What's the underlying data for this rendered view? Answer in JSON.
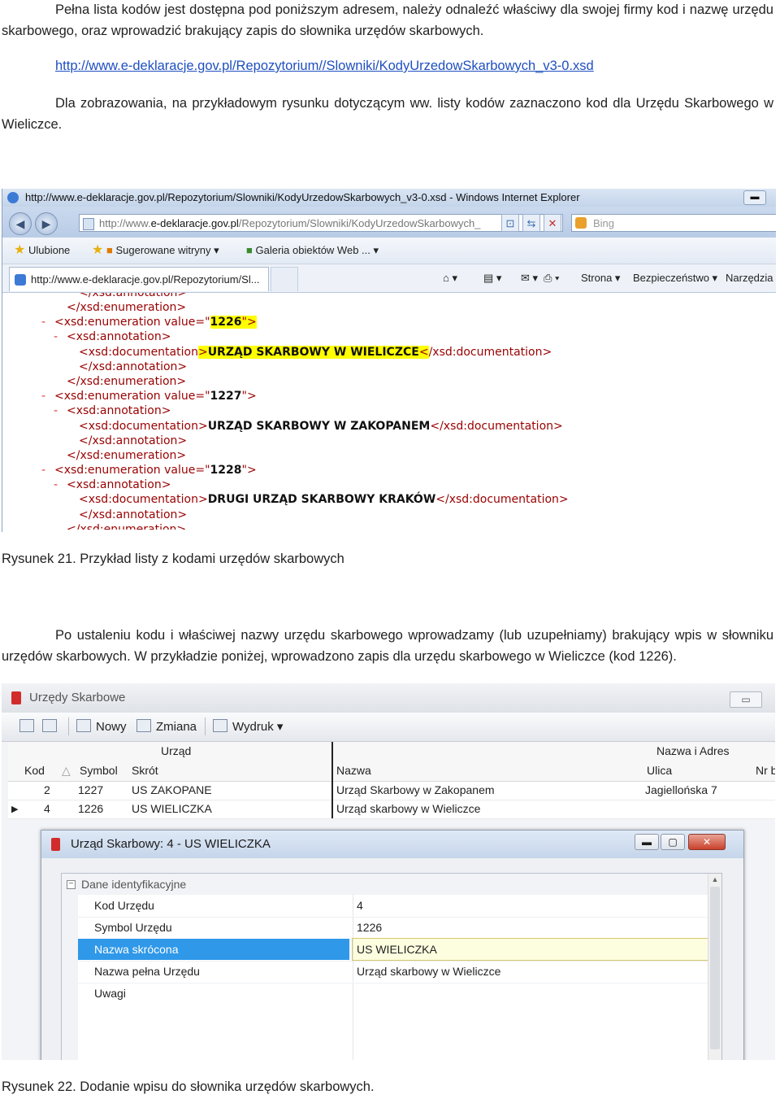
{
  "intro": {
    "text": "Pełna lista kodów jest dostępna pod poniższym adresem, należy odnaleźć właściwy dla swojej firmy kod i nazwę urzędu skarbowego, oraz wprowadzić brakujący zapis do słownika urzędów skarbowych.",
    "link": "http://www.e-deklaracje.gov.pl/Repozytorium//Slowniki/KodyUrzedowSkarbowych_v3-0.xsd",
    "example": "Dla zobrazowania, na przykładowym rysunku dotyczącym ww. listy kodów zaznaczono kod dla Urzędu Skarbowego w Wieliczce."
  },
  "figure21": {
    "window_title": "http://www.e-deklaracje.gov.pl/Repozytorium/Slowniki/KodyUrzedowSkarbowych_v3-0.xsd - Windows Internet Explorer",
    "address_prefix": "http://www.",
    "address_domain": "e-deklaracje.gov.pl",
    "address_rest": "/Repozytorium/Slowniki/KodyUrzedowSkarbowych_",
    "search_placeholder": "Bing",
    "favorites": [
      "Ulubione",
      "Sugerowane witryny ▾",
      "Galeria obiektów Web ... ▾"
    ],
    "tab_title": "http://www.e-deklaracje.gov.pl/Repozytorium/Sl...",
    "commands": [
      "Strona ▾",
      "Bezpieczeństwo ▾",
      "Narzędzia ▾"
    ],
    "xml_lines": [
      {
        "indent": 6,
        "marker": "",
        "tag": "</xsd:annotation>",
        "cut": true
      },
      {
        "indent": 5,
        "marker": "",
        "tag": "</xsd:enumeration>"
      },
      {
        "indent": 4,
        "marker": "-",
        "tag_open": "<xsd:enumeration value=\"",
        "value": "1226",
        "tag_close": "\">",
        "highlight": true
      },
      {
        "indent": 5,
        "marker": "-",
        "tag": "<xsd:annotation>"
      },
      {
        "indent": 6,
        "marker": "",
        "tag_open": "<xsd:documentation>",
        "value": "URZĄD SKARBOWY W WIELICZCE",
        "tag_close": "</xsd:documentation>",
        "highlight": true
      },
      {
        "indent": 6,
        "marker": "",
        "tag": "</xsd:annotation>"
      },
      {
        "indent": 5,
        "marker": "",
        "tag": "</xsd:enumeration>"
      },
      {
        "indent": 4,
        "marker": "-",
        "tag_open": "<xsd:enumeration value=\"",
        "value": "1227",
        "tag_close": "\">"
      },
      {
        "indent": 5,
        "marker": "-",
        "tag": "<xsd:annotation>"
      },
      {
        "indent": 6,
        "marker": "",
        "tag_open": "<xsd:documentation>",
        "value": "URZĄD SKARBOWY W ZAKOPANEM",
        "tag_close": "</xsd:documentation>"
      },
      {
        "indent": 6,
        "marker": "",
        "tag": "</xsd:annotation>"
      },
      {
        "indent": 5,
        "marker": "",
        "tag": "</xsd:enumeration>"
      },
      {
        "indent": 4,
        "marker": "-",
        "tag_open": "<xsd:enumeration value=\"",
        "value": "1228",
        "tag_close": "\">"
      },
      {
        "indent": 5,
        "marker": "-",
        "tag": "<xsd:annotation>"
      },
      {
        "indent": 6,
        "marker": "",
        "tag_open": "<xsd:documentation>",
        "value": "DRUGI URZĄD SKARBOWY KRAKÓW",
        "tag_close": "</xsd:documentation>"
      },
      {
        "indent": 6,
        "marker": "",
        "tag": "</xsd:annotation>"
      },
      {
        "indent": 5,
        "marker": "",
        "tag": "</xsd:enumeration>",
        "cut": true
      }
    ]
  },
  "caption21": "Rysunek 21. Przykład listy z kodami urzędów skarbowych",
  "body2": "Po ustaleniu kodu i właściwej nazwy urzędu skarbowego wprowadzamy (lub uzupełniamy) brakujący wpis w słowniku urzędów skarbowych.  W przykładzie poniżej, wprowadzono zapis dla urzędu skarbowego w Wieliczce (kod 1226).",
  "figure22": {
    "window_title": "Urzędy Skarbowe",
    "toolbar": {
      "new": "Nowy",
      "edit": "Zmiana",
      "print": "Wydruk"
    },
    "group_urzad": "Urząd",
    "group_adres": "Nazwa i Adres",
    "columns": [
      "Kod",
      "Symbol",
      "Skrót",
      "Nazwa",
      "Ulica",
      "Nr b"
    ],
    "rows": [
      {
        "kod": "2",
        "symbol": "1227",
        "skrot": "US ZAKOPANE",
        "nazwa": "Urząd Skarbowy w Zakopanem",
        "ulica": "Jagiellońska 7",
        "selected": false
      },
      {
        "kod": "4",
        "symbol": "1226",
        "skrot": "US WIELICZKA",
        "nazwa": "Urząd skarbowy w Wieliczce",
        "ulica": "",
        "selected": true
      }
    ],
    "dialog": {
      "title": "Urząd Skarbowy:  4  -  US WIELICZKA",
      "category": "Dane identyfikacyjne",
      "props": [
        {
          "key": "Kod Urzędu",
          "value": "4"
        },
        {
          "key": "Symbol Urzędu",
          "value": "1226"
        },
        {
          "key": "Nazwa skrócona",
          "value": "US WIELICZKA",
          "selected": true
        },
        {
          "key": "Nazwa pełna Urzędu",
          "value": "Urząd skarbowy w Wieliczce"
        },
        {
          "key": "Uwagi",
          "value": ""
        }
      ]
    }
  },
  "caption22": "Rysunek 22.  Dodanie wpisu do słownika urzędów skarbowych.",
  "colors": {
    "highlight": "#ffff00",
    "xml_tag": "#990000",
    "xml_marker": "#e03030",
    "link": "#1f4fbf",
    "selected_row": "#2f98e8"
  }
}
